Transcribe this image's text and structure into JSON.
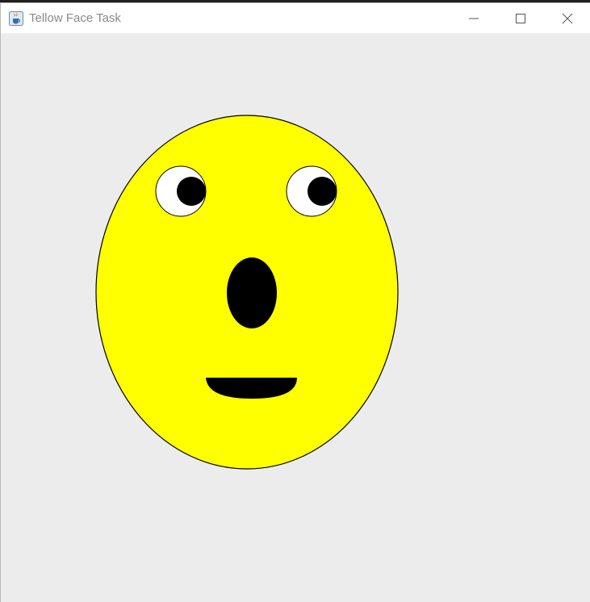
{
  "window": {
    "title": "Tellow Face Task",
    "icon": "java-cup-icon",
    "controls": {
      "minimize_icon": "minimize-icon",
      "maximize_icon": "maximize-icon",
      "close_icon": "close-icon"
    }
  },
  "face": {
    "face_color": "#ffff00",
    "outline_color": "#000000",
    "eye_white_color": "#ffffff",
    "pupil_color": "#000000",
    "nose_color": "#000000",
    "mouth_color": "#000000",
    "background_color": "#ececec"
  }
}
